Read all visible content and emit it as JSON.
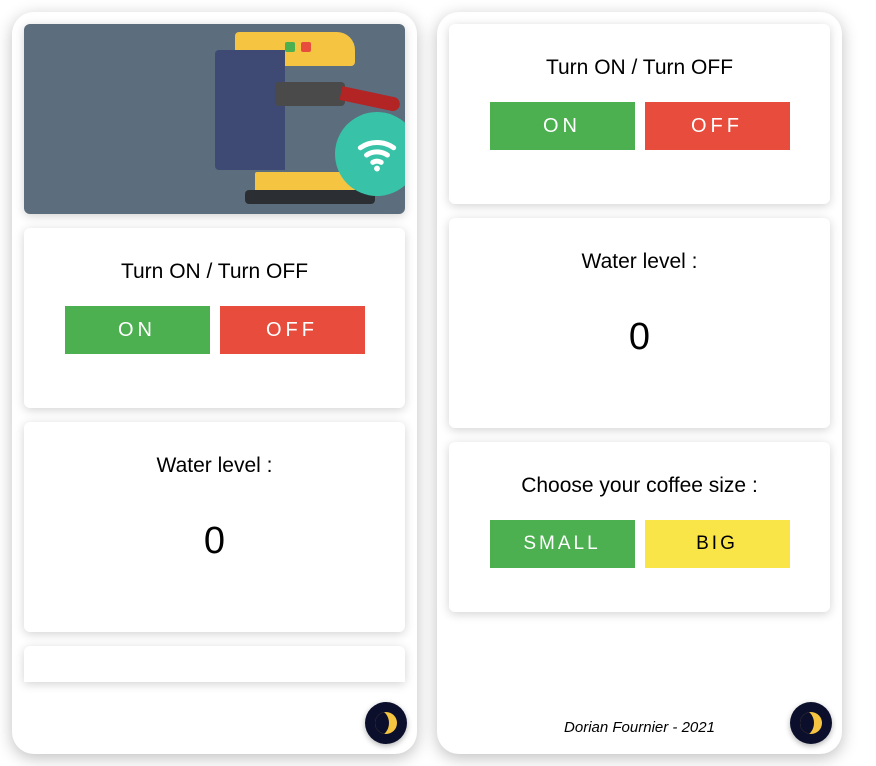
{
  "left": {
    "power": {
      "title": "Turn ON / Turn OFF",
      "on_label": "ON",
      "off_label": "OFF"
    },
    "water": {
      "title": "Water level :",
      "value": "0"
    }
  },
  "right": {
    "power": {
      "title": "Turn ON / Turn OFF",
      "on_label": "ON",
      "off_label": "OFF"
    },
    "water": {
      "title": "Water level :",
      "value": "0"
    },
    "size": {
      "title": "Choose your coffee size :",
      "small_label": "SMALL",
      "big_label": "BIG"
    },
    "footer": "Dorian Fournier - 2021"
  },
  "colors": {
    "green": "#4caf50",
    "red": "#e74c3c",
    "yellow": "#f9e548",
    "hero_bg": "#5c6d7e",
    "fab_bg": "#0b0f2b"
  },
  "icons": {
    "theme_toggle": "moon-icon",
    "hero": "coffee-machine-wifi-icon"
  }
}
